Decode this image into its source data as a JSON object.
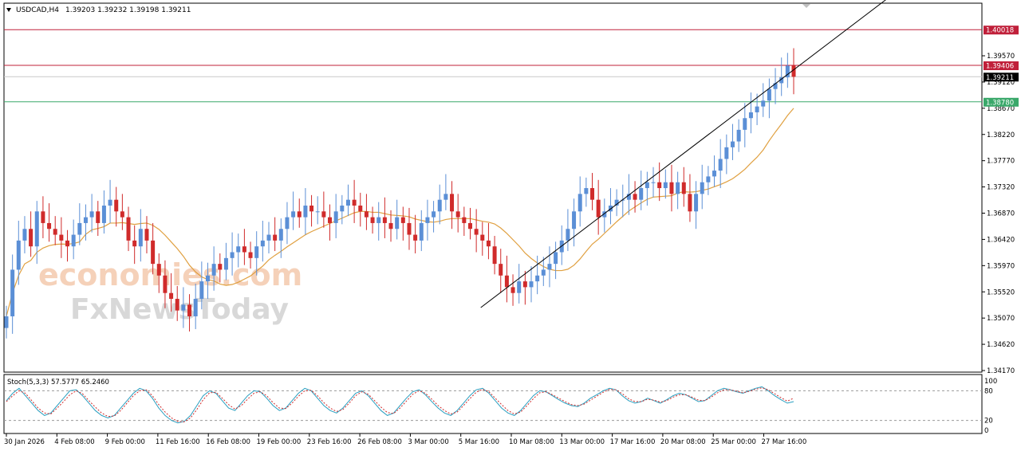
{
  "header": {
    "symbol": "USDCAD,H4",
    "ohlc": "1.39203 1.39232 1.39198 1.39211"
  },
  "watermark": {
    "line1": "economies.com",
    "line2": "FxNewsToday"
  },
  "colors": {
    "bull": "#5b8fd6",
    "bear": "#d02b2b",
    "ma": "#e0a040",
    "resistance": "#c0203a",
    "support": "#3aa86a",
    "current": "#000000",
    "stoch_main": "#2a9fc0",
    "stoch_signal": "#d02b2b",
    "axis": "#000000"
  },
  "chart_data": [
    {
      "type": "candlestick",
      "title": "USDCAD,H4",
      "ylim": [
        1.3395,
        1.4077
      ],
      "y_ticks": [
        "1.39570",
        "1.39120",
        "1.38670",
        "1.38220",
        "1.37770",
        "1.37320",
        "1.36870",
        "1.36420",
        "1.35970",
        "1.35520",
        "1.35070",
        "1.34620",
        "1.34170"
      ],
      "x_ticks": [
        "30 Jan 2026",
        "4 Feb 08:00",
        "9 Feb 00:00",
        "11 Feb 16:00",
        "16 Feb 08:00",
        "19 Feb 00:00",
        "23 Feb 16:00",
        "26 Feb 08:00",
        "3 Mar 00:00",
        "5 Mar 16:00",
        "10 Mar 08:00",
        "13 Mar 00:00",
        "17 Mar 16:00",
        "20 Mar 08:00",
        "25 Mar 00:00",
        "27 Mar 16:00"
      ],
      "series_close": [
        1.351,
        1.359,
        1.364,
        1.366,
        1.363,
        1.369,
        1.367,
        1.366,
        1.365,
        1.364,
        1.363,
        1.365,
        1.367,
        1.368,
        1.369,
        1.367,
        1.37,
        1.371,
        1.369,
        1.368,
        1.364,
        1.363,
        1.366,
        1.364,
        1.36,
        1.358,
        1.355,
        1.354,
        1.352,
        1.353,
        1.351,
        1.354,
        1.357,
        1.358,
        1.36,
        1.359,
        1.361,
        1.362,
        1.363,
        1.362,
        1.361,
        1.363,
        1.364,
        1.365,
        1.364,
        1.366,
        1.368,
        1.369,
        1.368,
        1.37,
        1.369,
        1.369,
        1.368,
        1.367,
        1.369,
        1.37,
        1.371,
        1.37,
        1.369,
        1.368,
        1.367,
        1.368,
        1.367,
        1.366,
        1.368,
        1.367,
        1.365,
        1.364,
        1.367,
        1.368,
        1.369,
        1.371,
        1.372,
        1.369,
        1.368,
        1.367,
        1.366,
        1.365,
        1.364,
        1.363,
        1.36,
        1.358,
        1.356,
        1.355,
        1.357,
        1.356,
        1.357,
        1.358,
        1.359,
        1.36,
        1.362,
        1.364,
        1.366,
        1.369,
        1.372,
        1.373,
        1.371,
        1.368,
        1.369,
        1.37,
        1.371,
        1.371,
        1.372,
        1.371,
        1.373,
        1.374,
        1.374,
        1.373,
        1.374,
        1.372,
        1.374,
        1.372,
        1.369,
        1.372,
        1.374,
        1.375,
        1.376,
        1.378,
        1.38,
        1.381,
        1.383,
        1.385,
        1.386,
        1.387,
        1.388,
        1.39,
        1.391,
        1.392,
        1.394,
        1.3921
      ],
      "current_price": "1.39211",
      "levels": [
        {
          "name": "resistance-upper",
          "price": 1.40018,
          "label": "1.40018"
        },
        {
          "name": "resistance",
          "price": 1.39406,
          "label": "1.39406"
        },
        {
          "name": "current",
          "price": 1.39211,
          "label": "1.39211"
        },
        {
          "name": "support",
          "price": 1.3878,
          "label": "1.38780"
        }
      ],
      "moving_average": "orange",
      "trendline": {
        "from": [
          "5 Mar 16:00",
          1.3525
        ],
        "to": [
          "27 Mar 16:00",
          1.392
        ]
      }
    },
    {
      "type": "line",
      "title": "Stoch(5,3,3) 57.5777 65.2460",
      "ylim": [
        0,
        100
      ],
      "y_ticks": [
        "100",
        "80",
        "20",
        "0"
      ],
      "levels": [
        80,
        20
      ],
      "series": [
        {
          "values": [
            60,
            75,
            85,
            70,
            55,
            40,
            30,
            35,
            50,
            65,
            80,
            82,
            70,
            55,
            40,
            30,
            25,
            30,
            45,
            60,
            75,
            85,
            80,
            65,
            45,
            30,
            20,
            15,
            18,
            30,
            50,
            70,
            80,
            75,
            60,
            45,
            40,
            55,
            70,
            80,
            78,
            65,
            50,
            40,
            45,
            60,
            75,
            85,
            80,
            65,
            50,
            40,
            35,
            45,
            60,
            75,
            80,
            70,
            55,
            40,
            30,
            35,
            50,
            65,
            78,
            82,
            72,
            58,
            45,
            35,
            30,
            40,
            55,
            70,
            82,
            85,
            75,
            60,
            45,
            35,
            30,
            40,
            55,
            70,
            80,
            78,
            70,
            62,
            55,
            50,
            48,
            55,
            65,
            72,
            80,
            85,
            82,
            70,
            60,
            55,
            58,
            65,
            60,
            55,
            62,
            70,
            75,
            72,
            65,
            58,
            60,
            70,
            80,
            85,
            82,
            78,
            75,
            80,
            85,
            88,
            80,
            70,
            62,
            55,
            58
          ]
        },
        {
          "values": [
            58,
            70,
            80,
            75,
            60,
            45,
            35,
            33,
            45,
            58,
            72,
            80,
            74,
            60,
            47,
            35,
            28,
            29,
            40,
            55,
            70,
            80,
            82,
            70,
            52,
            37,
            25,
            18,
            17,
            25,
            42,
            62,
            76,
            77,
            65,
            52,
            43,
            50,
            63,
            75,
            78,
            70,
            56,
            45,
            44,
            55,
            69,
            80,
            81,
            70,
            56,
            45,
            38,
            42,
            55,
            70,
            78,
            73,
            60,
            47,
            36,
            34,
            45,
            59,
            73,
            80,
            75,
            63,
            50,
            40,
            33,
            37,
            50,
            64,
            77,
            83,
            78,
            65,
            52,
            40,
            33,
            37,
            50,
            64,
            76,
            78,
            72,
            65,
            58,
            52,
            50,
            53,
            61,
            69,
            77,
            83,
            82,
            74,
            64,
            58,
            58,
            63,
            61,
            57,
            60,
            67,
            72,
            72,
            67,
            61,
            60,
            67,
            76,
            82,
            82,
            79,
            76,
            79,
            83,
            86,
            82,
            74,
            66,
            59,
            65
          ]
        }
      ]
    }
  ]
}
